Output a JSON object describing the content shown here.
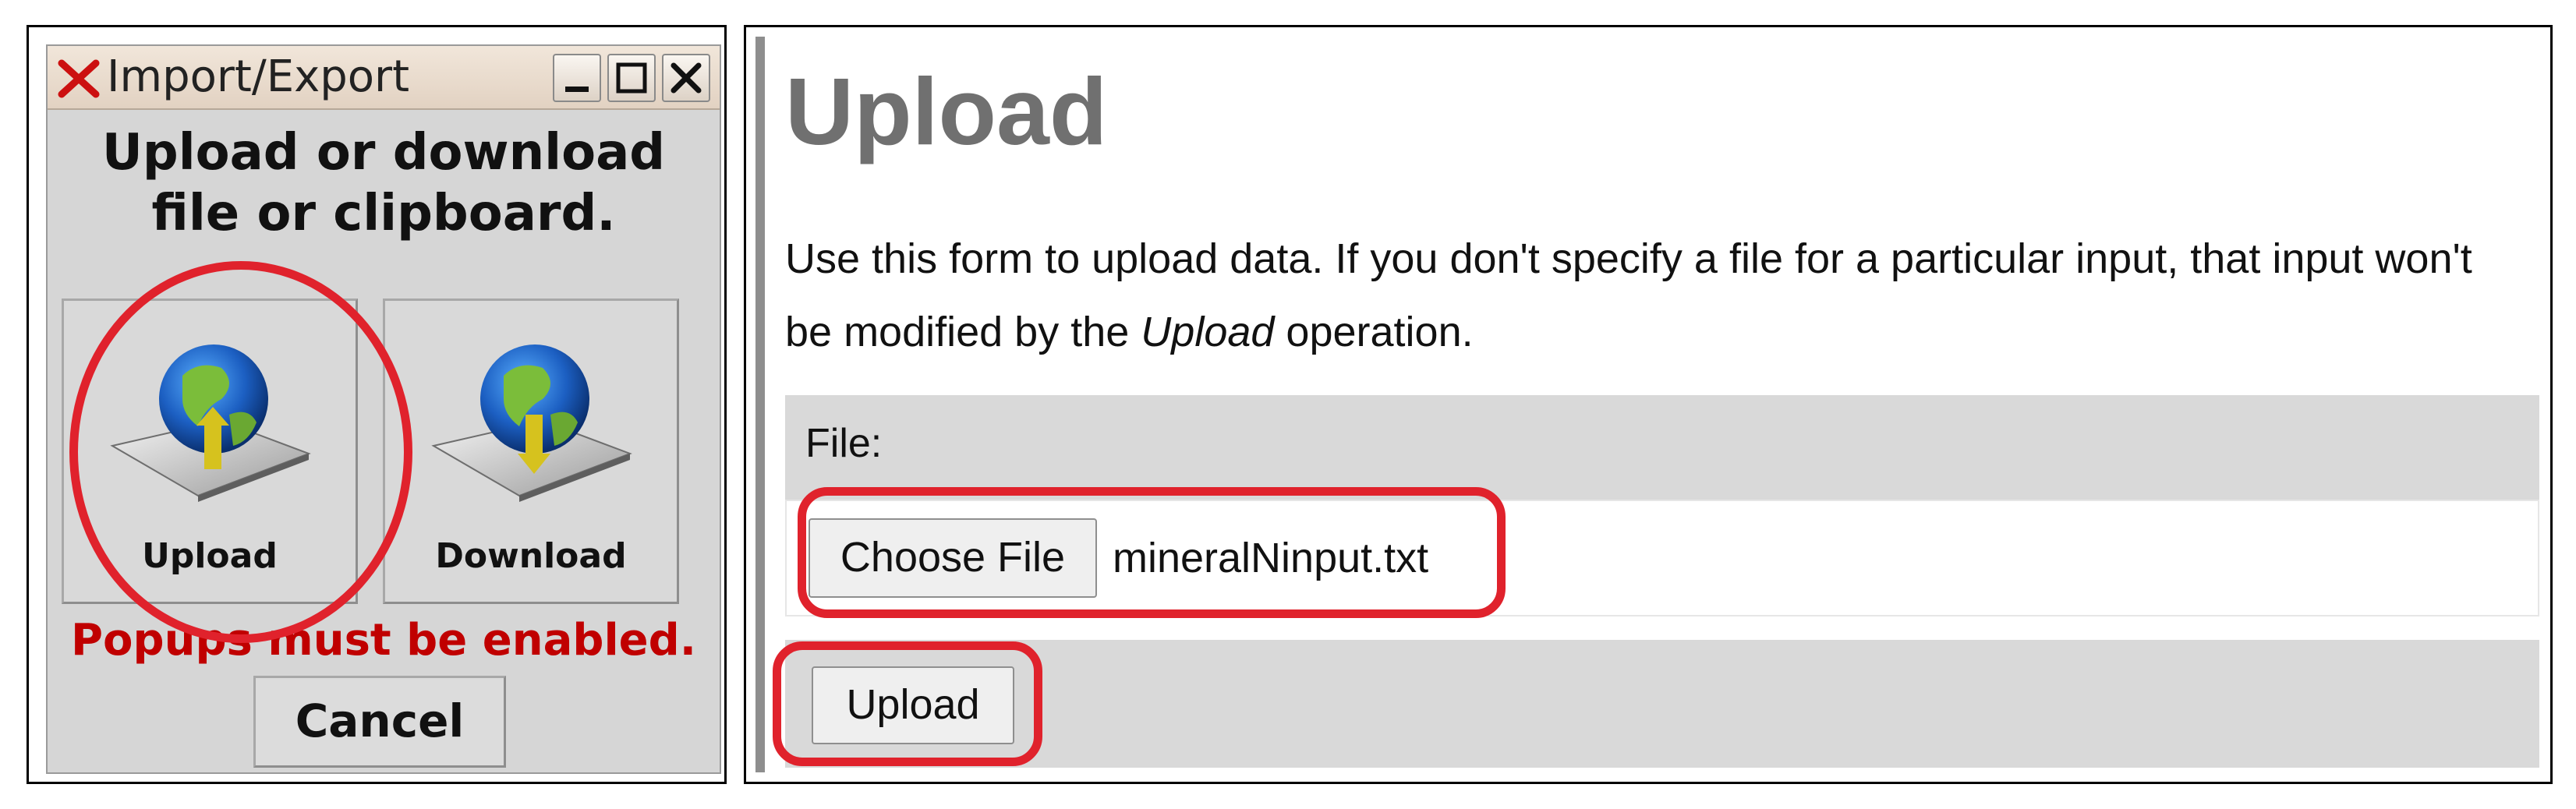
{
  "dialog": {
    "title": "Import/Export",
    "heading_line1": "Upload or download",
    "heading_line2": "file or clipboard.",
    "upload_label": "Upload",
    "download_label": "Download",
    "warning": "Popups must be enabled.",
    "cancel_label": "Cancel",
    "icons": [
      "x-app-icon",
      "minimize-icon",
      "maximize-icon",
      "close-icon",
      "globe-upload-icon",
      "globe-download-icon"
    ]
  },
  "form": {
    "title": "Upload",
    "description_part1": "Use this form to upload data. If you don't specify a file for a particular input, that input won't be modified by the ",
    "description_emphasis": "Upload",
    "description_part2": " operation.",
    "file_label": "File:",
    "choose_file_label": "Choose File",
    "file_name": "mineralNinput.txt",
    "submit_label": "Upload"
  },
  "colors": {
    "highlight": "#e0222c",
    "warning": "#c00000",
    "title_gray": "#707070",
    "row_gray": "#d9d9d9"
  }
}
